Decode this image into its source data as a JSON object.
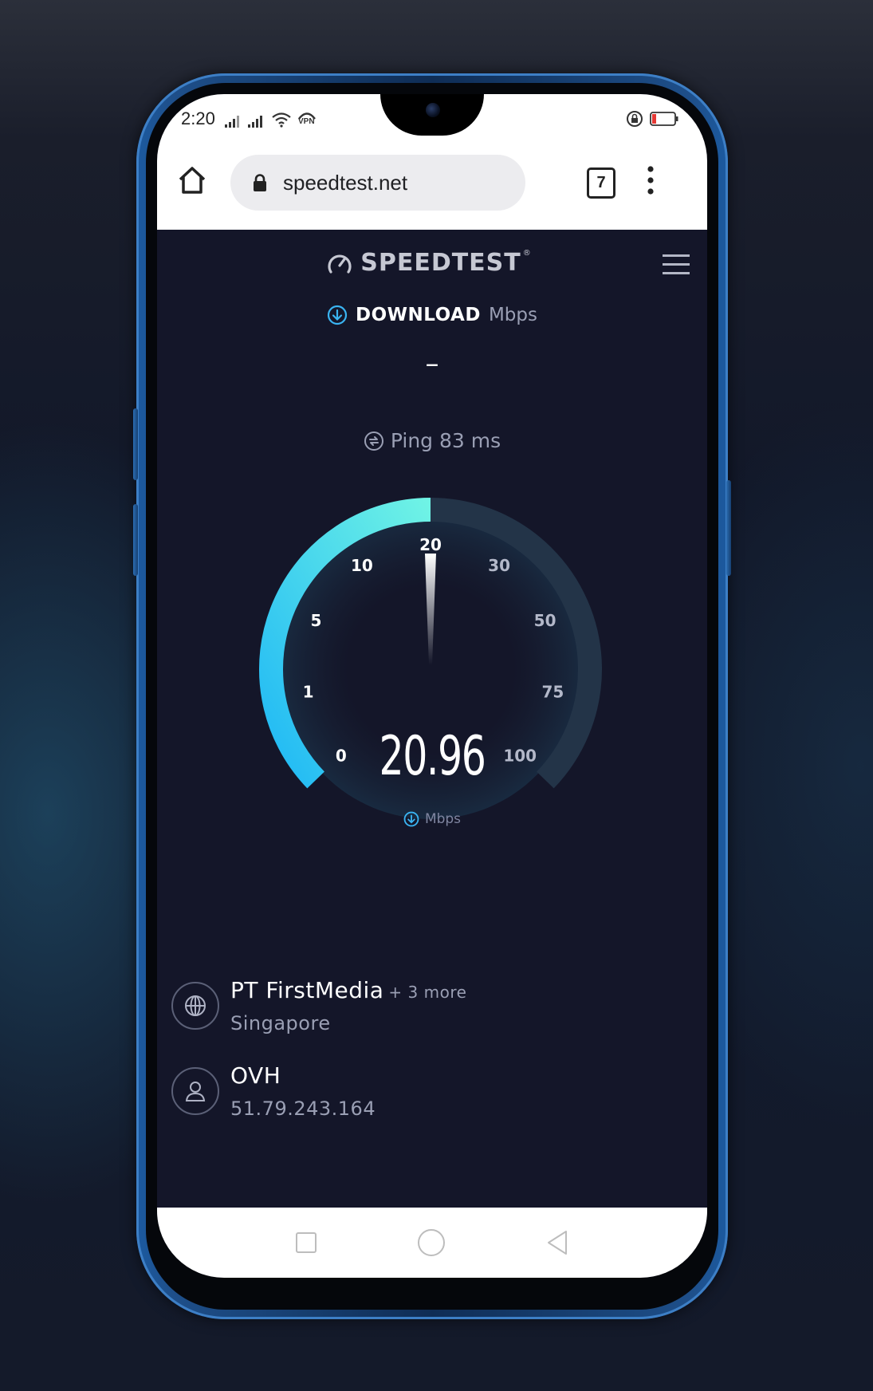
{
  "status_bar": {
    "time": "2:20",
    "icons": [
      "signal-1-icon",
      "signal-2-icon",
      "wifi-icon",
      "vpn-icon",
      "rotation-lock-icon",
      "battery-low-icon"
    ],
    "vpn_label": "VPN"
  },
  "browser": {
    "url": "speedtest.net",
    "tab_count": "7",
    "icons": [
      "home-icon",
      "lock-icon",
      "more-vert-icon"
    ]
  },
  "app": {
    "logo_text": "SPEEDTEST",
    "logo_tm": "®",
    "download_label": "DOWNLOAD",
    "download_unit": "Mbps",
    "download_result": "–",
    "ping_label": "Ping 83 ms",
    "gauge": {
      "ticks": [
        "0",
        "1",
        "5",
        "10",
        "20",
        "30",
        "50",
        "75",
        "100"
      ],
      "current_speed": "20.96",
      "unit": "Mbps",
      "current_value": 20.96,
      "fill_fraction": 0.5,
      "colors": {
        "fill_start": "#1fb8f5",
        "fill_end": "#6ff3e5",
        "track": "#233448"
      }
    },
    "isp": {
      "name": "PT FirstMedia",
      "more": "+ 3 more",
      "location": "Singapore"
    },
    "server": {
      "name": "OVH",
      "ip": "51.79.243.164"
    }
  },
  "nav_bar": {
    "icons": [
      "recent-apps-icon",
      "home-circle-icon",
      "back-icon"
    ]
  }
}
